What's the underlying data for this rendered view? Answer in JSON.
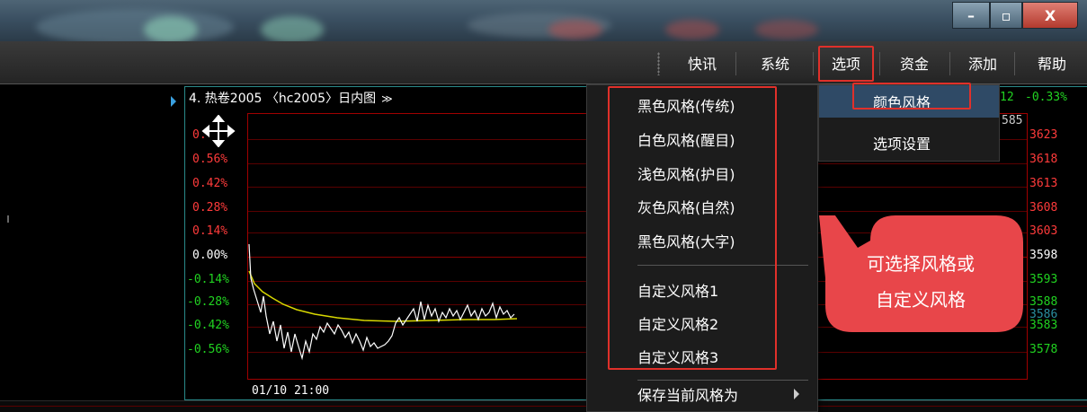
{
  "menubar": {
    "items": [
      {
        "label": "快讯"
      },
      {
        "label": "系统"
      },
      {
        "label": "选项"
      },
      {
        "label": "资金"
      },
      {
        "label": "添加"
      },
      {
        "label": "帮助"
      }
    ]
  },
  "window": {
    "min_glyph": "–",
    "max_glyph": "▫",
    "close_glyph": "X"
  },
  "chart": {
    "title": "4. 热卷2005 〈hc2005〉日内图",
    "title_menu_glyph": "≫",
    "left_axis": [
      "0.",
      "0.56%",
      "0.42%",
      "0.28%",
      "0.14%",
      "0.00%",
      "-0.14%",
      "-0.28%",
      "-0.42%",
      "-0.56%"
    ],
    "right_axis": [
      "3623",
      "3618",
      "3613",
      "3608",
      "3603",
      "3598",
      "3593",
      "3588",
      "3583",
      "3578"
    ],
    "right_overlay": "3586",
    "partial_top_right": "585",
    "quote_price": "12",
    "quote_change": "-0.33%",
    "x_label": "01/10 21:00"
  },
  "dropdown_styles": {
    "items": [
      {
        "label": "黑色风格(传统)"
      },
      {
        "label": "白色风格(醒目)"
      },
      {
        "label": "浅色风格(护目)"
      },
      {
        "label": "灰色风格(自然)"
      },
      {
        "label": "黑色风格(大字)"
      },
      {
        "label": "自定义风格1"
      },
      {
        "label": "自定义风格2"
      },
      {
        "label": "自定义风格3"
      },
      {
        "label": "保存当前风格为"
      }
    ]
  },
  "dropdown_options": {
    "items": [
      {
        "label": "颜色风格"
      },
      {
        "label": "选项设置"
      }
    ]
  },
  "callout": {
    "line1": "可选择风格或",
    "line2": "自定义风格"
  },
  "colors": {
    "highlight_red": "#e0302a",
    "callout_red": "#e8464a",
    "axis_red": "#ff3b3b",
    "axis_green": "#21d321",
    "menu_highlight": "#2f4a66"
  }
}
